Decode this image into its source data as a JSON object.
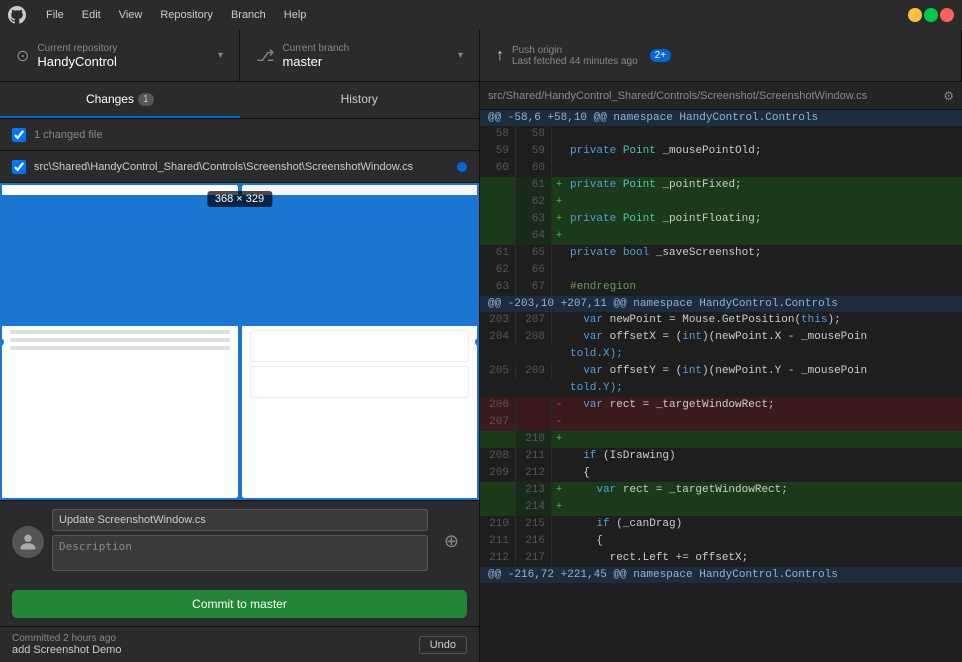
{
  "titlebar": {
    "menus": [
      "File",
      "Edit",
      "View",
      "Repository",
      "Branch",
      "Help"
    ],
    "window_controls": [
      "minimize",
      "maximize",
      "close"
    ]
  },
  "topbar": {
    "repo_label": "Current repository",
    "repo_name": "HandyControl",
    "branch_label": "Current branch",
    "branch_name": "master",
    "push_label": "Push origin",
    "push_sub": "Last fetched 44 minutes ago",
    "push_badge": "2+"
  },
  "left": {
    "tabs": [
      {
        "label": "Changes",
        "badge": "1",
        "active": true
      },
      {
        "label": "History",
        "badge": "",
        "active": false
      }
    ],
    "changed_header": "1 changed file",
    "files": [
      {
        "path": "src\\Shared\\HandyControl_Shared\\Controls\\Screenshot\\ScreenshotWindow.cs",
        "checked": true
      }
    ],
    "diff_label": "368 × 329",
    "commit": {
      "summary": "Update ScreenshotWindow.cs",
      "description": "Description",
      "button": "Commit to master"
    },
    "bottom": {
      "time": "Committed 2 hours ago",
      "message": "add Screenshot Demo",
      "undo": "Undo"
    }
  },
  "right": {
    "path": "src/Shared/HandyControl_Shared/Controls/Screenshot/ScreenshotWindow.cs",
    "hunk1": "@@ -58,6 +58,10 @@ namespace HandyControl.Controls",
    "hunk2": "@@ -203,10 +207,11 @@ namespace HandyControl.Controls",
    "hunk3": "@@ -216,72 +221,45 @@ namespace HandyControl.Controls",
    "lines": []
  }
}
